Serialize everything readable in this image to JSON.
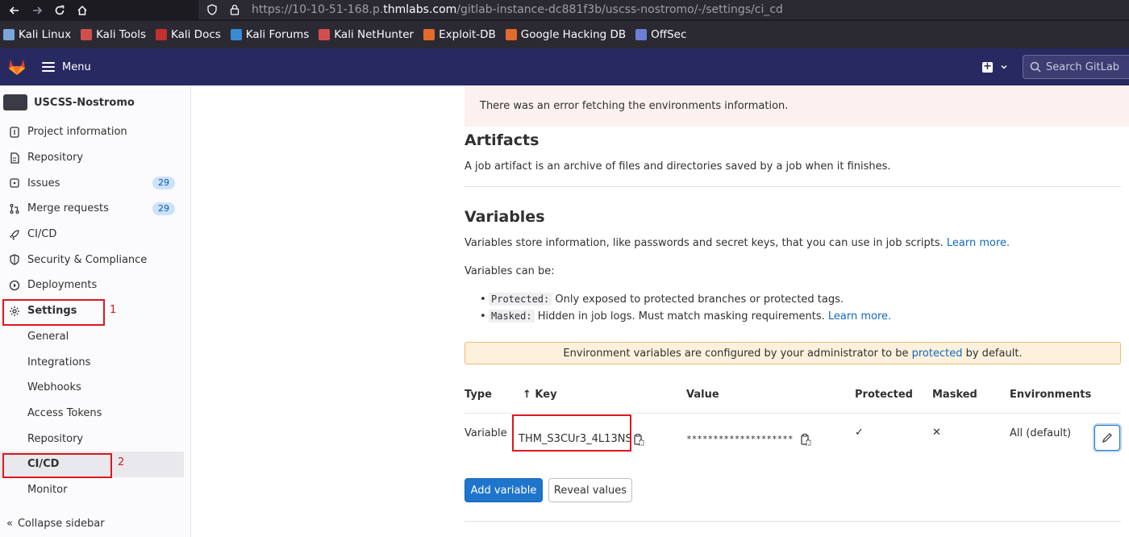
{
  "browser": {
    "url_prefix": "https://10-10-51-168.p.",
    "url_host": "thmlabs.com",
    "url_path": "/gitlab-instance-dc881f3b/uscss-nostromo/-/settings/ci_cd",
    "bookmarks": [
      {
        "label": "Kali Linux",
        "color": "#7aa6da"
      },
      {
        "label": "Kali Tools",
        "color": "#d04e4e"
      },
      {
        "label": "Kali Docs",
        "color": "#c0312f"
      },
      {
        "label": "Kali Forums",
        "color": "#3a8ad6"
      },
      {
        "label": "Kali NetHunter",
        "color": "#d04e4e"
      },
      {
        "label": "Exploit-DB",
        "color": "#e26a2c"
      },
      {
        "label": "Google Hacking DB",
        "color": "#e26a2c"
      },
      {
        "label": "OffSec",
        "color": "#6a7fd6"
      }
    ]
  },
  "header": {
    "menu_label": "Menu",
    "search_placeholder": "Search GitLab"
  },
  "sidebar": {
    "project_name": "USCSS-Nostromo",
    "items": [
      {
        "label": "Project information",
        "icon": "info-icon"
      },
      {
        "label": "Repository",
        "icon": "document-icon"
      },
      {
        "label": "Issues",
        "icon": "issues-icon",
        "badge": "29"
      },
      {
        "label": "Merge requests",
        "icon": "merge-request-icon",
        "badge": "29"
      },
      {
        "label": "CI/CD",
        "icon": "rocket-icon"
      },
      {
        "label": "Security & Compliance",
        "icon": "shield-icon"
      },
      {
        "label": "Deployments",
        "icon": "deployments-icon"
      },
      {
        "label": "Settings",
        "icon": "gear-icon"
      }
    ],
    "settings_sub": [
      "General",
      "Integrations",
      "Webhooks",
      "Access Tokens",
      "Repository",
      "CI/CD",
      "Monitor"
    ],
    "collapse_label": "Collapse sidebar"
  },
  "annotations": {
    "one": "1",
    "two": "2"
  },
  "main": {
    "env_error": "There was an error fetching the environments information.",
    "artifacts_title": "Artifacts",
    "artifacts_desc": "A job artifact is an archive of files and directories saved by a job when it finishes.",
    "variables_title": "Variables",
    "variables_desc": "Variables store information, like passwords and secret keys, that you can use in job scripts.",
    "learn_more": "Learn more.",
    "variables_can_be": "Variables can be:",
    "protected_code": "Protected:",
    "protected_desc": "Only exposed to protected branches or protected tags.",
    "masked_code": "Masked:",
    "masked_desc": "Hidden in job logs. Must match masking requirements.",
    "learn_more_2": "Learn more.",
    "env_alert_prefix": "Environment variables are configured by your administrator to be",
    "env_alert_link": "protected",
    "env_alert_suffix": "by default.",
    "table": {
      "headers": {
        "type": "Type",
        "key": "↑ Key",
        "value": "Value",
        "protected": "Protected",
        "masked": "Masked",
        "environments": "Environments"
      },
      "rows": [
        {
          "type": "Variable",
          "key": "THM_S3CUr3_4L13NS",
          "value": "********************",
          "protected": "✓",
          "masked": "✕",
          "environments": "All (default)"
        }
      ]
    },
    "add_variable": "Add variable",
    "reveal_values": "Reveal values"
  }
}
